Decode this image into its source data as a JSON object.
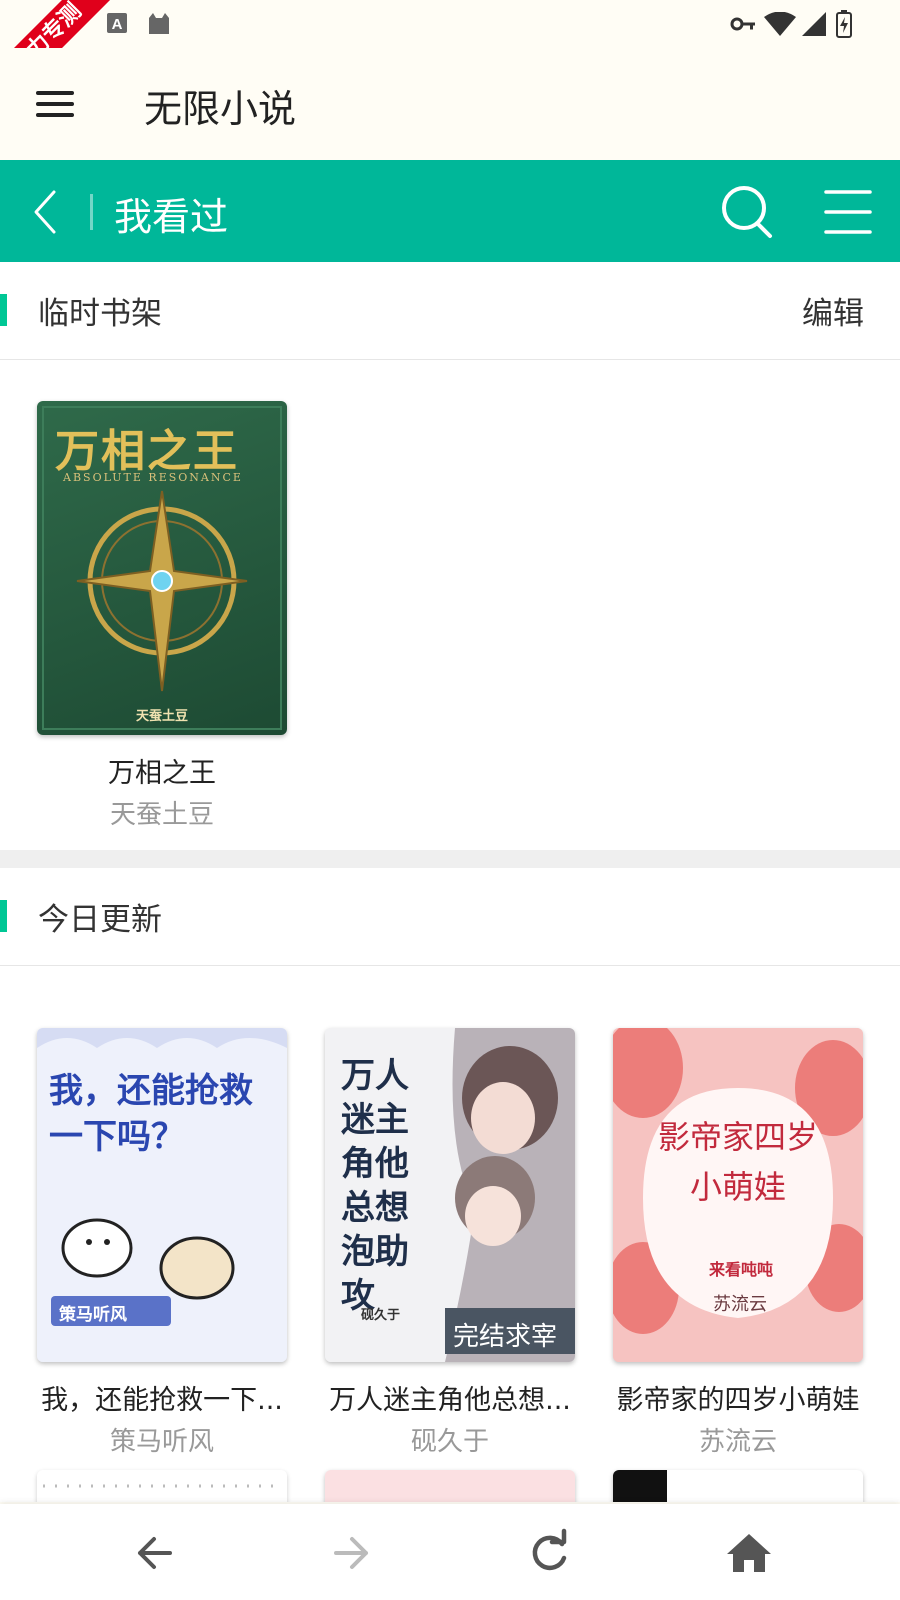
{
  "ribbon": {
    "label": "圣力专测"
  },
  "app_bar": {
    "title": "无限小说"
  },
  "nav_header": {
    "title": "我看过"
  },
  "temp_shelf": {
    "title": "临时书架",
    "action": "编辑",
    "books": [
      {
        "title": "万相之王",
        "author": "天蚕土豆",
        "cover_title": "万相之王",
        "cover_subtitle": "ABSOLUTE RESONANCE",
        "cover_author": "天蚕土豆"
      }
    ]
  },
  "today_updates": {
    "title": "今日更新",
    "books": [
      {
        "title": "我，还能抢救一下...",
        "author": "策马听风",
        "cover_title": "我，还能抢救一下吗？",
        "cover_author": "策马听风"
      },
      {
        "title": "万人迷主角他总想...",
        "author": "砚久于",
        "cover_title": "万人迷主角他总想泡助攻",
        "cover_badge": "完结求宰",
        "cover_author": "砚久于"
      },
      {
        "title": "影帝家的四岁小萌娃",
        "author": "苏流云",
        "cover_title": "影帝家四岁小萌娃",
        "cover_sub": "来看吨吨",
        "cover_author": "苏流云"
      }
    ]
  },
  "colors": {
    "accent": "#00b799",
    "section_bar": "#00c795",
    "ribbon": "#e0001b"
  },
  "icons": [
    "menu-icon",
    "back-icon",
    "search-icon",
    "list-icon",
    "arrow-left-icon",
    "arrow-right-icon",
    "refresh-icon",
    "home-icon"
  ]
}
